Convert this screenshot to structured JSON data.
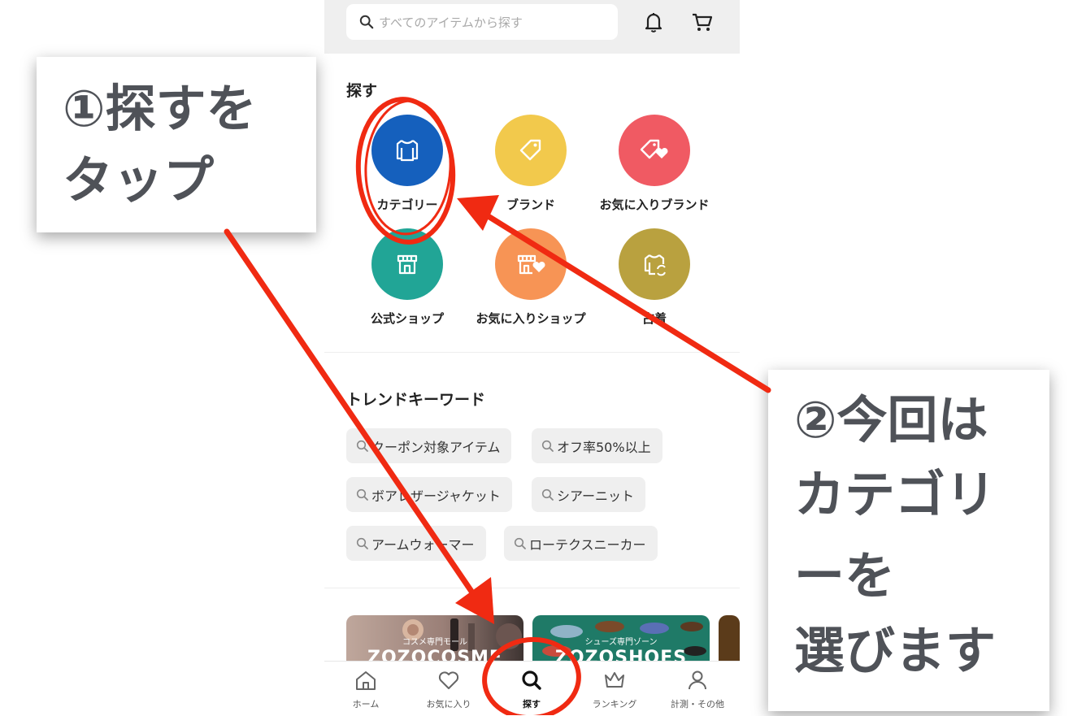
{
  "search": {
    "placeholder": "すべてのアイテムから探す"
  },
  "explore": {
    "title": "探す",
    "categories": [
      {
        "label": "カテゴリー",
        "color": "#1560bd",
        "icon": "shirt-icon"
      },
      {
        "label": "ブランド",
        "color": "#f2c94c",
        "icon": "tag-icon"
      },
      {
        "label": "お気に入りブランド",
        "color": "#f05a63",
        "icon": "tag-heart-icon"
      },
      {
        "label": "公式ショップ",
        "color": "#21a596",
        "icon": "shop-icon"
      },
      {
        "label": "お気に入りショップ",
        "color": "#f79455",
        "icon": "shop-heart-icon"
      },
      {
        "label": "古着",
        "color": "#b9a13f",
        "icon": "used-clothes-icon"
      }
    ]
  },
  "trend": {
    "title": "トレンドキーワード",
    "keywords": [
      "クーポン対象アイテム",
      "オフ率50%以上",
      "ボアレザージャケット",
      "シアーニット",
      "アームウォーマー",
      "ローテクスニーカー"
    ]
  },
  "banners": [
    {
      "sub": "コスメ専門モール",
      "name": "ZOZOCOSME"
    },
    {
      "sub": "シューズ専門ゾーン",
      "name": "ZOZOSHOES"
    }
  ],
  "tabs": [
    {
      "label": "ホーム",
      "icon": "home-icon"
    },
    {
      "label": "お気に入り",
      "icon": "heart-icon"
    },
    {
      "label": "探す",
      "icon": "search-icon"
    },
    {
      "label": "ランキング",
      "icon": "crown-icon"
    },
    {
      "label": "計測・その他",
      "icon": "person-icon"
    }
  ],
  "callouts": {
    "step1": [
      "①探すを",
      "タップ"
    ],
    "step2": [
      "②今回は",
      "カテゴリ",
      "ーを",
      "選びます"
    ]
  },
  "colors": {
    "annotation": "#f02a12",
    "callout_text": "#4f5258",
    "topbar": "#efefef"
  }
}
